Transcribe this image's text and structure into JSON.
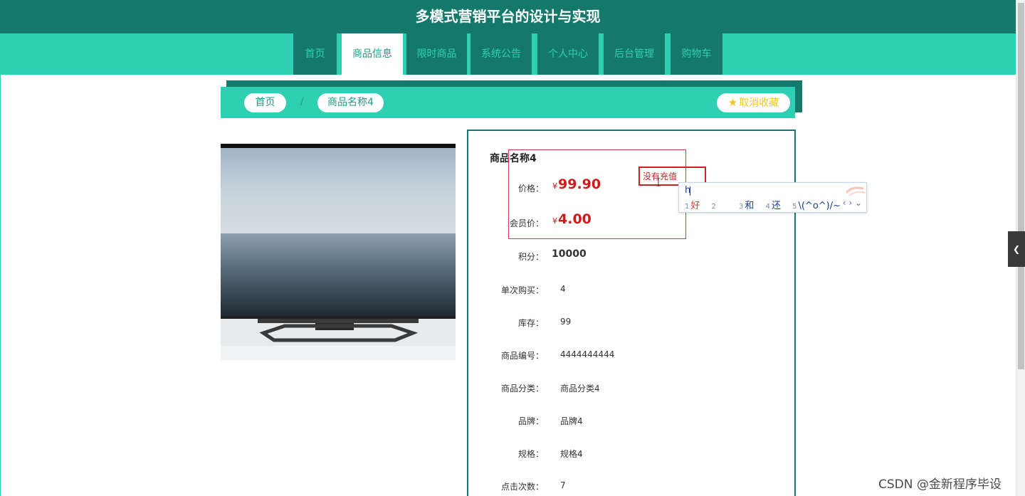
{
  "header": {
    "title": "多模式营销平台的设计与实现"
  },
  "nav": {
    "tabs": [
      {
        "label": "首页"
      },
      {
        "label": "商品信息"
      },
      {
        "label": "限时商品"
      },
      {
        "label": "系统公告"
      },
      {
        "label": "个人中心"
      },
      {
        "label": "后台管理"
      },
      {
        "label": "购物车"
      }
    ],
    "active_index": 1
  },
  "breadcrumb": {
    "home": "首页",
    "separator": "/",
    "current": "商品名称4",
    "favorite_label": "取消收藏",
    "favorite_icon": "star-icon"
  },
  "product": {
    "name": "商品名称4",
    "price_label": "价格：",
    "price_currency": "¥",
    "price": "99.90",
    "member_price_label": "会员价：",
    "member_price": "4.00",
    "points_label": "积分：",
    "points": "10000",
    "fields": [
      {
        "label": "单次购买：",
        "value": "4"
      },
      {
        "label": "库存：",
        "value": "99"
      },
      {
        "label": "商品编号：",
        "value": "4444444444"
      },
      {
        "label": "商品分类：",
        "value": "商品分类4"
      },
      {
        "label": "品牌：",
        "value": "品牌4"
      },
      {
        "label": "规格：",
        "value": "规格4"
      },
      {
        "label": "点击次数：",
        "value": "7"
      }
    ]
  },
  "annotation": {
    "note": "没有充值"
  },
  "ime": {
    "input": "h",
    "candidates": [
      {
        "num": "1",
        "text": "好"
      },
      {
        "num": "2",
        "text": ""
      },
      {
        "num": "3",
        "text": "和"
      },
      {
        "num": "4",
        "text": "还"
      },
      {
        "num": "5",
        "text": "\\(^o^)/~"
      }
    ],
    "arrows": "‹ › ⌄"
  },
  "watermark": "CSDN @金新程序毕设",
  "colors": {
    "primary_dark": "#14796a",
    "primary_light": "#2ecfb3",
    "price_red": "#d11a1a",
    "star_gold": "#f2c51b"
  }
}
